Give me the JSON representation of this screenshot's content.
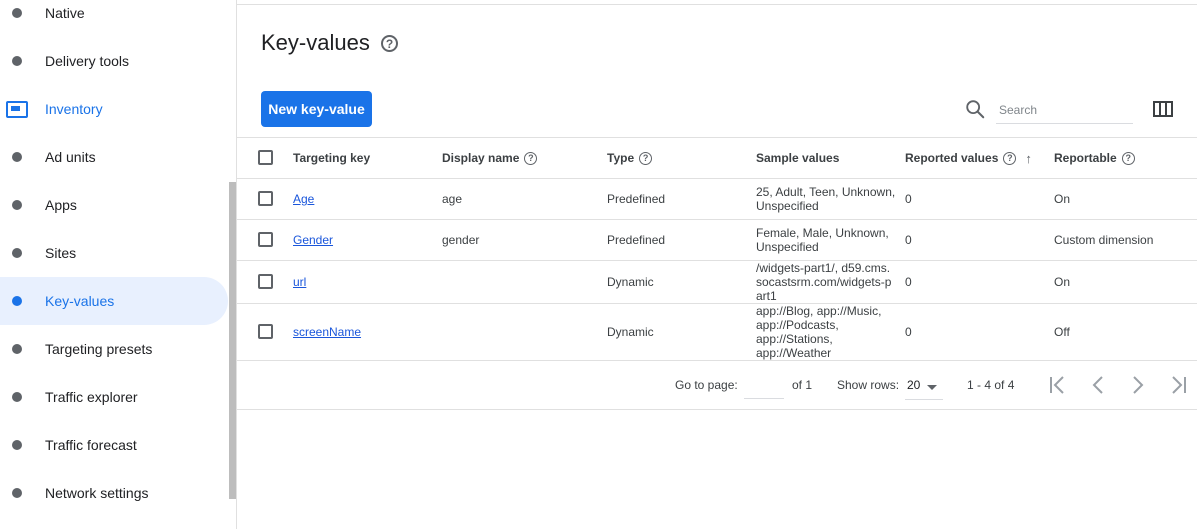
{
  "sidebar": {
    "items": [
      {
        "label": "Native",
        "kind": "dot"
      },
      {
        "label": "Delivery tools",
        "kind": "dot"
      },
      {
        "label": "Inventory",
        "kind": "section"
      },
      {
        "label": "Ad units",
        "kind": "dot"
      },
      {
        "label": "Apps",
        "kind": "dot"
      },
      {
        "label": "Sites",
        "kind": "dot"
      },
      {
        "label": "Key-values",
        "kind": "active"
      },
      {
        "label": "Targeting presets",
        "kind": "dot"
      },
      {
        "label": "Traffic explorer",
        "kind": "dot"
      },
      {
        "label": "Traffic forecast",
        "kind": "dot"
      },
      {
        "label": "Network settings",
        "kind": "dot"
      }
    ]
  },
  "header": {
    "title": "Key-values",
    "help_icon": "help-circle-icon"
  },
  "toolbar": {
    "new_label": "New key-value",
    "search_placeholder": "Search",
    "search_icon": "search-icon",
    "columns_icon": "view-columns-icon"
  },
  "table": {
    "headers": {
      "key": "Targeting key",
      "display": "Display name",
      "type": "Type",
      "sample": "Sample values",
      "reported": "Reported values",
      "reportable": "Reportable"
    },
    "rows": [
      {
        "key": "Age",
        "display": "age",
        "type": "Predefined",
        "sample": "25, Adult, Teen, Unknown, Unspecified",
        "reported": "0",
        "reportable": "On"
      },
      {
        "key": "Gender",
        "display": "gender",
        "type": "Predefined",
        "sample": "Female, Male, Unknown, Unspecified",
        "reported": "0",
        "reportable": "Custom dimension"
      },
      {
        "key": "url",
        "display": "",
        "type": "Dynamic",
        "sample": "/widgets-part1/, d59.cms.socastsrm.com/widgets-part1",
        "reported": "0",
        "reportable": "On"
      },
      {
        "key": "screenName",
        "display": "",
        "type": "Dynamic",
        "sample": "app://Blog, app://Music, app://Podcasts, app://Stations, app://Weather",
        "reported": "0",
        "reportable": "Off"
      }
    ]
  },
  "pager": {
    "goto_label": "Go to page:",
    "of_label": "of 1",
    "show_rows_label": "Show rows:",
    "rows_value": "20",
    "range": "1 - 4 of 4"
  },
  "colors": {
    "accent": "#1a73e8",
    "active_bg": "#e8f0fe"
  }
}
